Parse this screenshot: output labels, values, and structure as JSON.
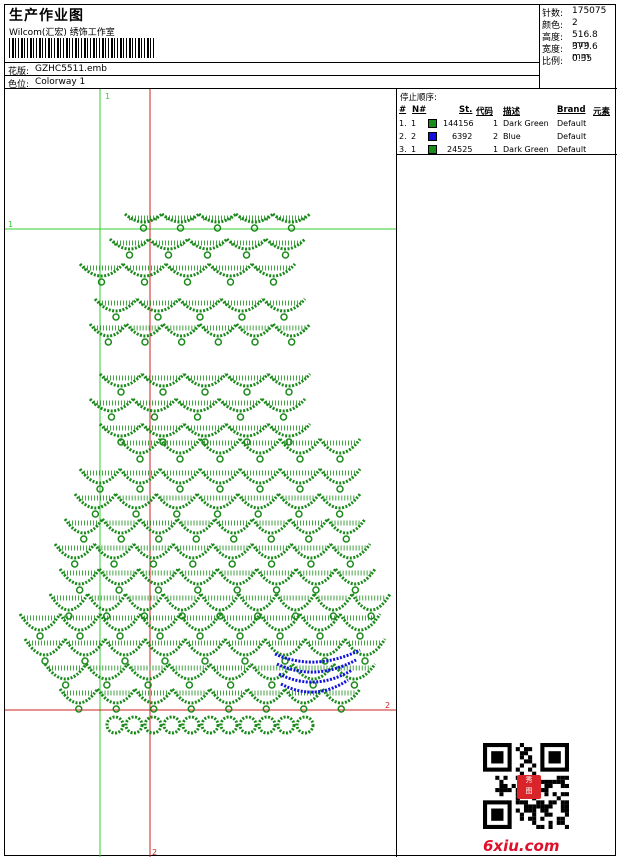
{
  "header": {
    "title": "生产作业图",
    "software": "Wilcom(汇宏) 绣饰工作室",
    "design_label": "花版:",
    "design_value": "GZHC5511.emb",
    "colorway_label": "色位:",
    "colorway_value": "Colorway 1"
  },
  "stats": [
    {
      "label": "针数:",
      "value": "175075"
    },
    {
      "label": "颜色:",
      "value": "2"
    },
    {
      "label": "高度:",
      "value": "516.8 mm"
    },
    {
      "label": "宽度:",
      "value": "373.6 mm"
    },
    {
      "label": "比例:",
      "value": "0.35"
    }
  ],
  "stop_sequence": {
    "title": "停止顺序:",
    "headers": {
      "num": "#",
      "n": "N#",
      "st": "St.",
      "code": "代码",
      "desc": "描述",
      "brand": "Brand",
      "elem": "元素"
    },
    "rows": [
      {
        "num": "1.",
        "n": "1",
        "color": "#1a8a1a",
        "st": "144156",
        "code": "1",
        "desc": "Dark Green",
        "brand": "Default"
      },
      {
        "num": "2.",
        "n": "2",
        "color": "#1010e0",
        "st": "6392",
        "code": "2",
        "desc": "Blue",
        "brand": "Default"
      },
      {
        "num": "3.",
        "n": "1",
        "color": "#1a8a1a",
        "st": "24525",
        "code": "1",
        "desc": "Dark Green",
        "brand": "Default"
      }
    ]
  },
  "guides": {
    "green_v_label": "1",
    "green_h_label": "1",
    "red_h_label": "2",
    "red_v_label": "2"
  },
  "colors": {
    "green": "#1a8a1a",
    "blue": "#1010e0",
    "guide_green": "#33cc33",
    "guide_red": "#cc2222"
  },
  "footer": {
    "site": "6xiu.com"
  }
}
